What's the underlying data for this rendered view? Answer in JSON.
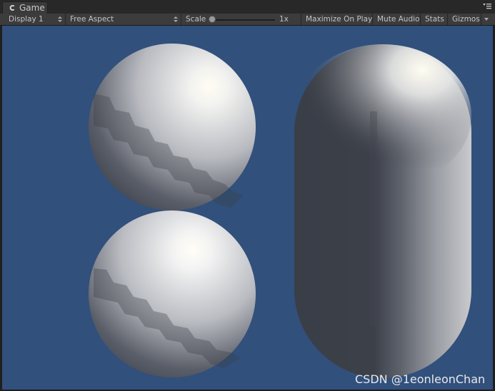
{
  "window": {
    "tab_label": "Game",
    "tab_icon": "unity-game-icon",
    "menu_icon": "tab-menu-icon"
  },
  "toolbar": {
    "display": "Display 1",
    "aspect": "Free Aspect",
    "scale_label": "Scale",
    "scale_value": "1x",
    "maximize_on_play": "Maximize On Play",
    "mute_audio": "Mute Audio",
    "stats": "Stats",
    "gizmos": "Gizmos"
  },
  "scene": {
    "background_color": "#31507c",
    "objects": [
      "sphere",
      "sphere",
      "capsule"
    ]
  },
  "watermark": "CSDN @1eonleonChan"
}
